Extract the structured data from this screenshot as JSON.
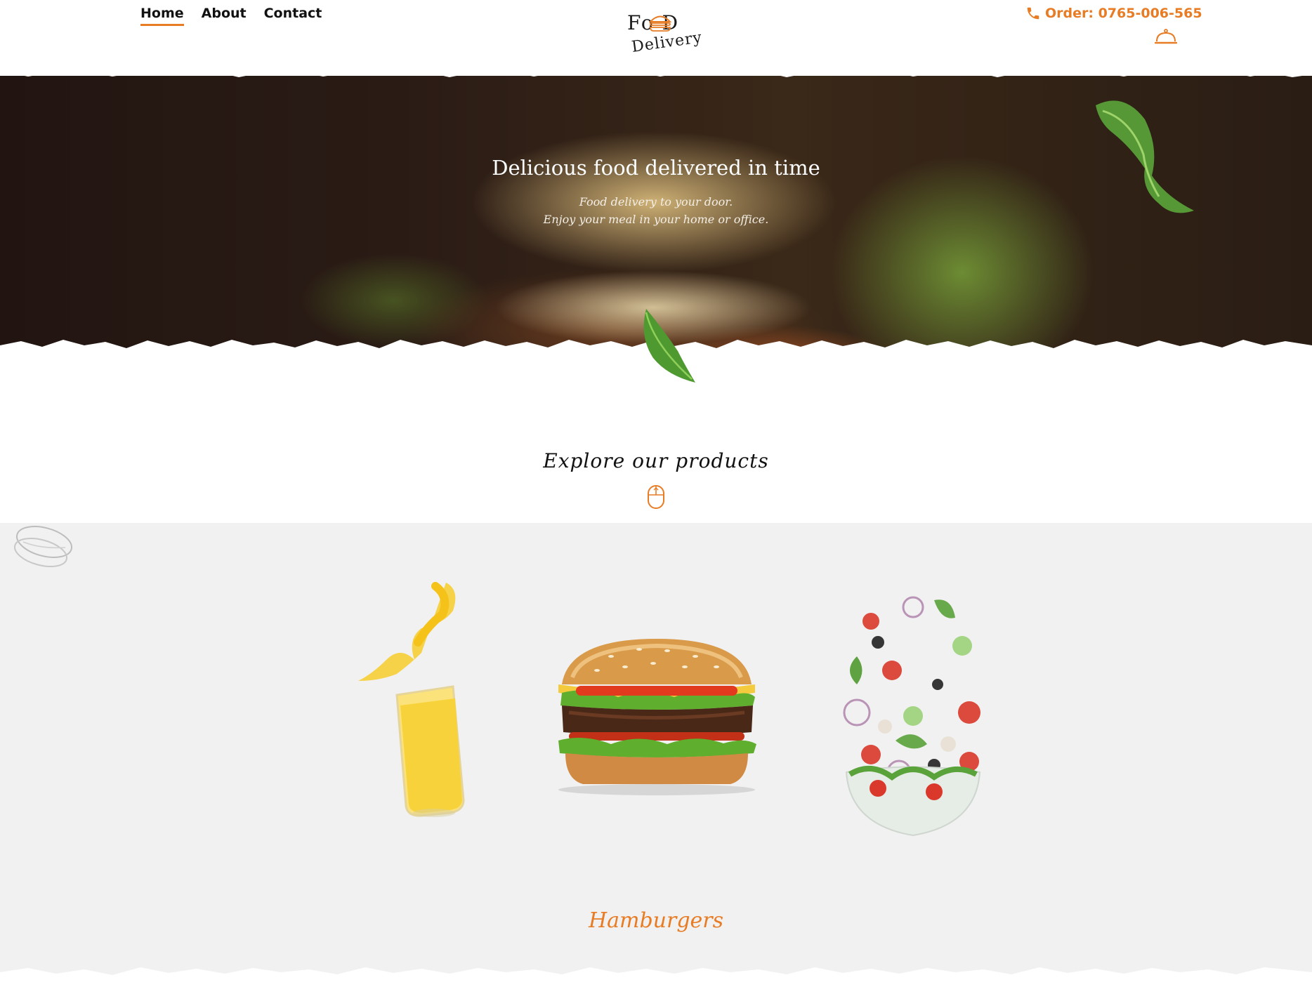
{
  "nav": {
    "items": [
      {
        "label": "Home",
        "active": true
      },
      {
        "label": "About",
        "active": false
      },
      {
        "label": "Contact",
        "active": false
      }
    ]
  },
  "logo": {
    "line1": "Fo D",
    "line2": "Delivery"
  },
  "header": {
    "order_text": "Order: 0765-006-565",
    "phone_icon": "phone-icon",
    "cart_icon": "cloche-icon"
  },
  "hero": {
    "title": "Delicious food delivered in time",
    "subtitle_line1": "Food delivery to your door.",
    "subtitle_line2": "Enjoy your meal in your home or office."
  },
  "explore": {
    "title": "Explore our products",
    "scroll_icon": "mouse-scroll-icon"
  },
  "products": {
    "items": [
      {
        "name": "juice",
        "icon": "juice-glass-image"
      },
      {
        "name": "hamburger",
        "icon": "hamburger-image"
      },
      {
        "name": "salad",
        "icon": "salad-bowl-image"
      }
    ],
    "selected_category": "Hamburgers"
  },
  "colors": {
    "accent": "#e87c25",
    "text": "#111111",
    "section_bg": "#f1f1f1"
  }
}
